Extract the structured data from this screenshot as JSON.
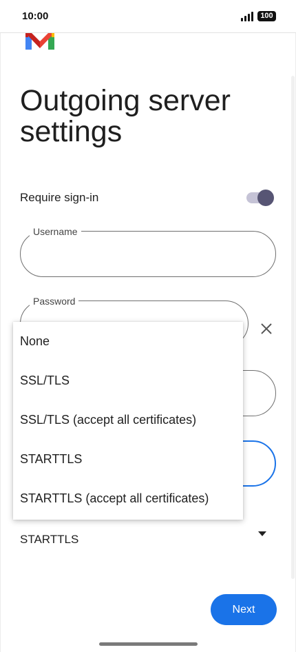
{
  "status_bar": {
    "time": "10:00",
    "battery": "100"
  },
  "page": {
    "title": "Outgoing server settings"
  },
  "require_signin": {
    "label": "Require sign-in",
    "enabled": true
  },
  "username": {
    "label": "Username",
    "value": ""
  },
  "password": {
    "label": "Password",
    "value": ""
  },
  "security_type": {
    "selected": "STARTTLS",
    "options": [
      "None",
      "SSL/TLS",
      "SSL/TLS (accept all certificates)",
      "STARTTLS",
      "STARTTLS (accept all certificates)"
    ]
  },
  "actions": {
    "next_label": "Next"
  },
  "colors": {
    "accent": "#1a73e8",
    "toggle_thumb": "#575574",
    "toggle_track": "#c5c3d6"
  },
  "icons": {
    "logo": "gmail-logo",
    "clear": "close-icon",
    "dropdown": "dropdown-arrow-icon",
    "password_toggle": "visibility-icon"
  }
}
